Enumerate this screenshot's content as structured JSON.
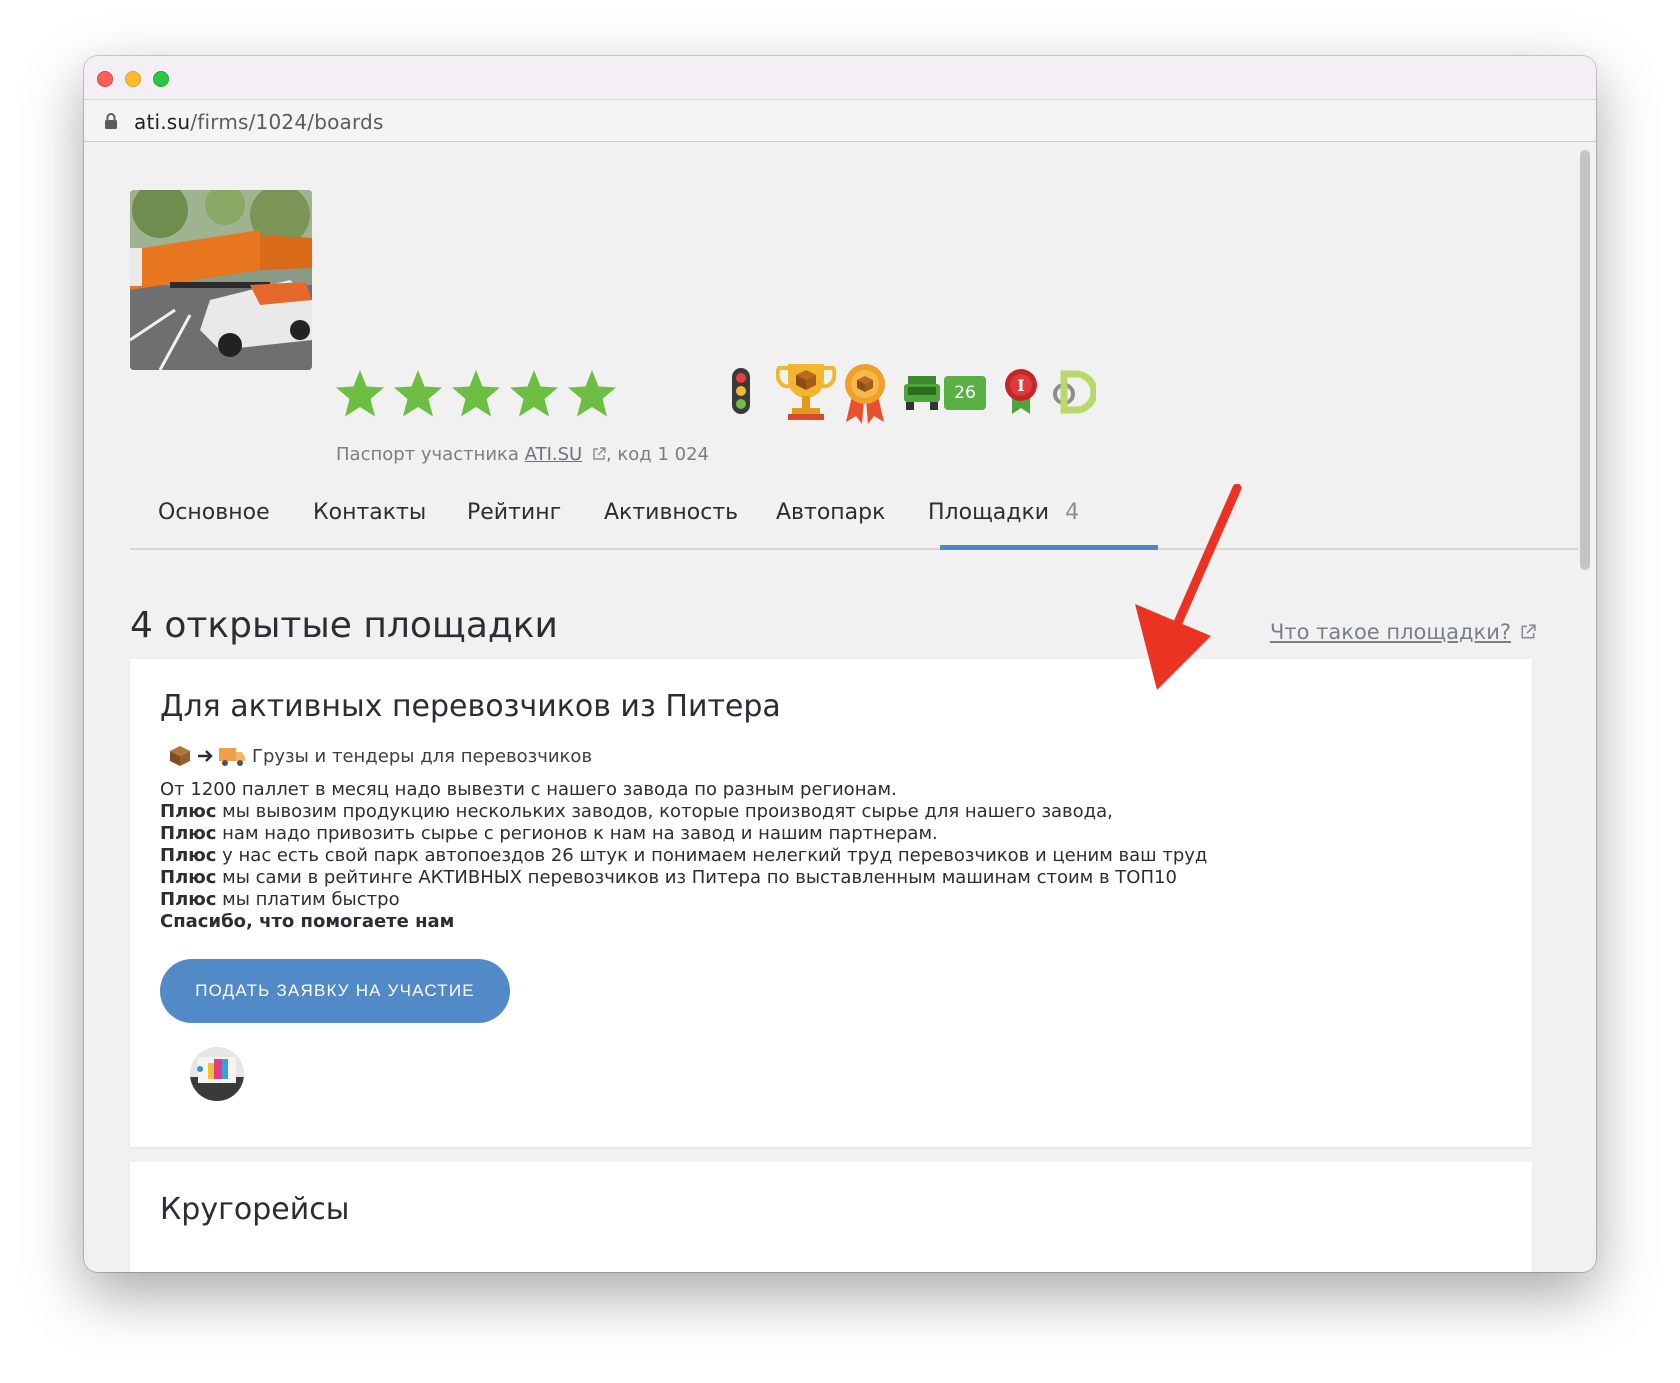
{
  "browser": {
    "url_host": "ati.su",
    "url_path": "/firms/1024/boards"
  },
  "profile": {
    "rating_stars": 5,
    "passport_prefix": "Паспорт участника ",
    "passport_link": "ATI.SU",
    "passport_suffix": ", код 1 024",
    "fleet_count_badge": "26",
    "accent_color": "#5289c7",
    "star_color": "#6cbf43"
  },
  "tabs": [
    {
      "label": "Основное"
    },
    {
      "label": "Контакты"
    },
    {
      "label": "Рейтинг"
    },
    {
      "label": "Активность"
    },
    {
      "label": "Автопарк"
    },
    {
      "label": "Площадки",
      "count": "4",
      "active": true
    }
  ],
  "boards": {
    "title": "4 открытые площадки",
    "help_link": "Что такое площадки?",
    "cards": [
      {
        "title": "Для активных перевозчиков из Питера",
        "type_label": "Грузы и тендеры для перевозчиков",
        "desc_line1": "От 1200 паллет в месяц надо вывезти с нашего завода по разным регионам.",
        "plus_word": "Плюс",
        "desc_line2": " мы вывозим продукцию нескольких заводов, которые производят сырье для нашего завода,",
        "desc_line3": " нам надо привозить сырье с регионов к нам на завод и нашим партнерам.",
        "desc_line4": " у нас есть свой парк автопоездов 26 штук и понимаем нелегкий труд перевозчиков и ценим ваш труд",
        "desc_line5": " мы сами в рейтинге АКТИВНЫХ перевозчиков из Питера по выставленным машинам стоим в ТОП10",
        "desc_line6": " мы платим быстро",
        "desc_thanks": "Спасибо, что помогаете нам",
        "apply_button": "ПОДАТЬ ЗАЯВКУ НА УЧАСТИЕ"
      },
      {
        "title": "Кругорейсы"
      }
    ]
  }
}
